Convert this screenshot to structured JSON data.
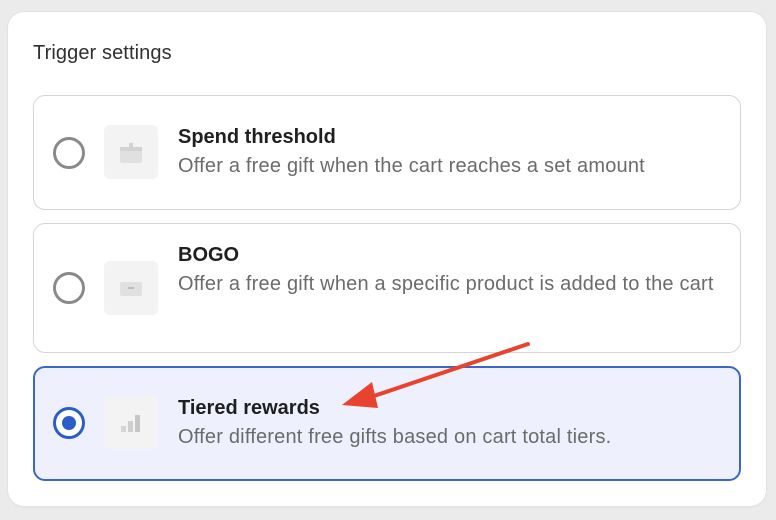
{
  "section": {
    "title": "Trigger settings"
  },
  "options": [
    {
      "title": "Spend threshold",
      "description": "Offer a free gift when the cart reaches a set amount",
      "selected": false,
      "icon": "gift-box-icon"
    },
    {
      "title": "BOGO",
      "description": "Offer a free gift when a specific product is added to the cart",
      "selected": false,
      "icon": "product-tag-icon"
    },
    {
      "title": "Tiered rewards",
      "description": "Offer different free gifts based on cart total tiers.",
      "selected": true,
      "icon": "bar-chart-icon"
    }
  ],
  "colors": {
    "accent": "#2c5cc5",
    "selected_bg": "#eef1fd",
    "annotation_arrow": "#e8432f"
  }
}
